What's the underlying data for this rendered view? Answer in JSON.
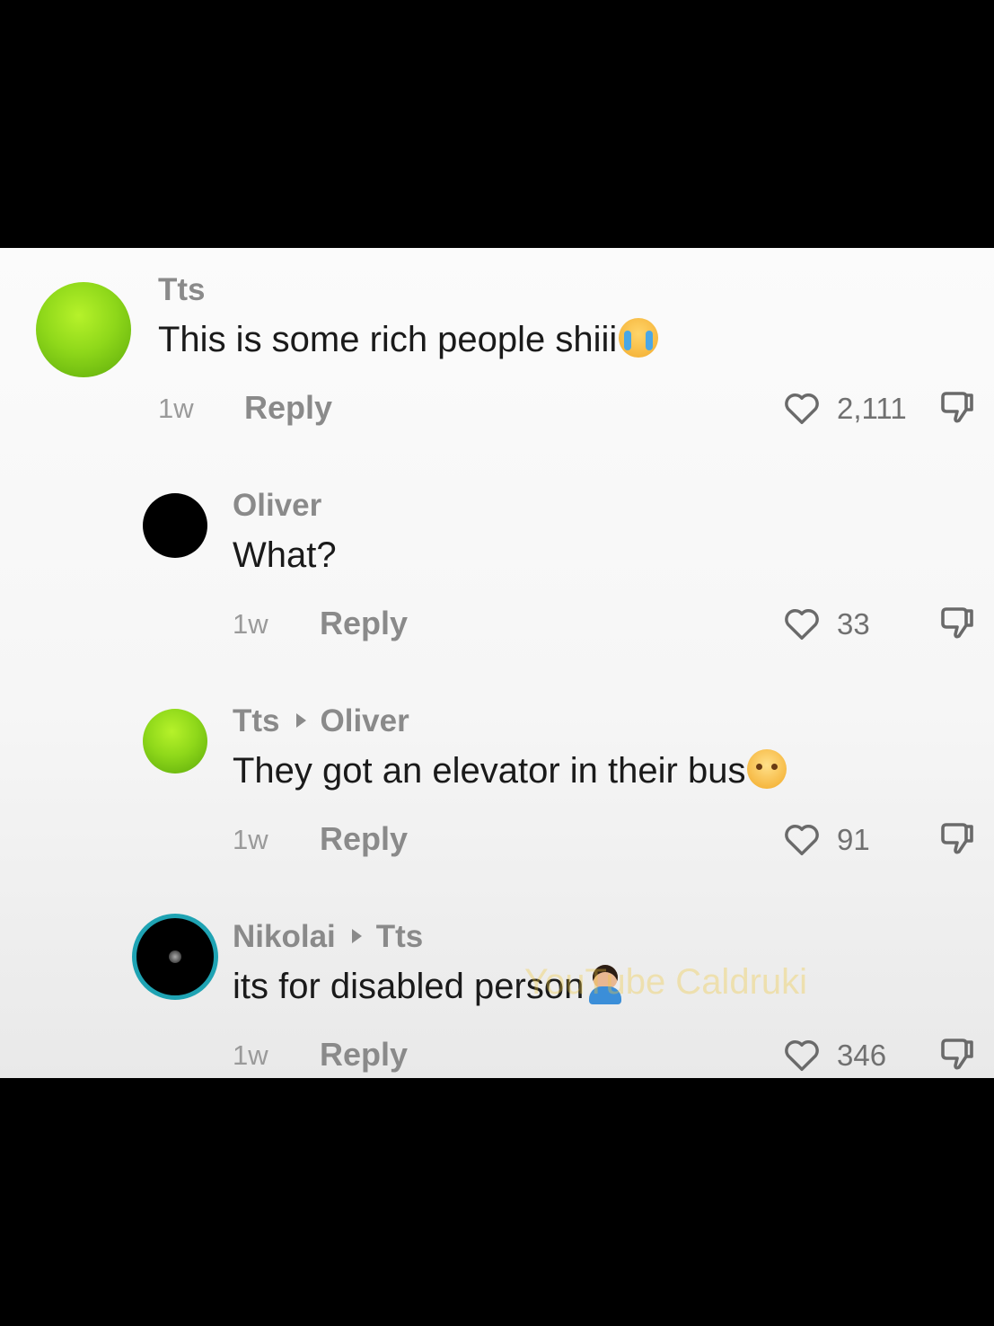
{
  "comments": [
    {
      "username": "Tts",
      "reply_to": "",
      "text": "This is some rich people shiii",
      "emoji": "loudly-crying-face-icon",
      "time": "1w",
      "reply_label": "Reply",
      "likes": "2,111"
    },
    {
      "username": "Oliver",
      "reply_to": "",
      "text": "What?",
      "emoji": "",
      "time": "1w",
      "reply_label": "Reply",
      "likes": "33"
    },
    {
      "username": "Tts",
      "reply_to": "Oliver",
      "text": "They got an elevator in their bus",
      "emoji": "pleading-face-icon",
      "time": "1w",
      "reply_label": "Reply",
      "likes": "91"
    },
    {
      "username": "Nikolai",
      "reply_to": "Tts",
      "text": "its for disabled person",
      "emoji": "person-facepalming-icon",
      "time": "1w",
      "reply_label": "Reply",
      "likes": "346"
    }
  ],
  "watermark": "YouTube Caldruki",
  "colors": {
    "background_bars": "#000000",
    "panel": "#f7f7f7",
    "username": "#8a8a8a",
    "text": "#1a1a1a",
    "avatar_green": "#8fd81a",
    "avatar_ring": "#1fa3b3"
  }
}
